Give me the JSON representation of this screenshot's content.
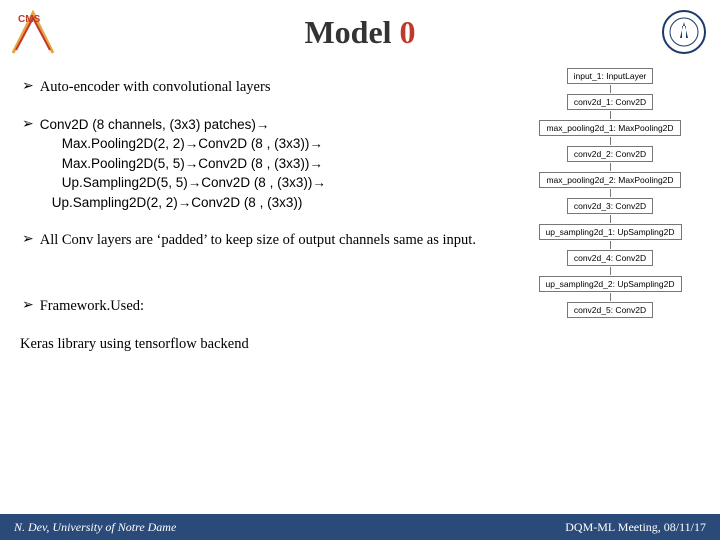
{
  "title_main": "Model ",
  "title_accent": "0",
  "logos": {
    "left_alt": "CMS logo",
    "right_alt": "Notre Dame seal"
  },
  "bullets": {
    "b1": "Auto-encoder with convolutional layers",
    "b2_l1": "Conv2D (8 channels, (3x3) patches)→",
    "b2_l2": "Max.Pooling2D(2, 2)→Conv2D (8 , (3x3))→",
    "b2_l3": "Max.Pooling2D(5, 5)→Conv2D (8 , (3x3))→",
    "b2_l4": "Up.Sampling2D(5, 5)→Conv2D (8 , (3x3))→",
    "b2_l5": "Up.Sampling2D(2, 2)→Conv2D (8 , (3x3))",
    "b3": "All Conv layers are ‘padded’ to keep size of output channels same as input.",
    "b4_l1": "Framework.Used:",
    "b4_l2": "Keras library using tensorflow backend"
  },
  "diagram": {
    "n1": "input_1: InputLayer",
    "n2": "conv2d_1: Conv2D",
    "n3": "max_pooling2d_1: MaxPooling2D",
    "n4": "conv2d_2: Conv2D",
    "n5": "max_pooling2d_2: MaxPooling2D",
    "n6": "conv2d_3: Conv2D",
    "n7": "up_sampling2d_1: UpSampling2D",
    "n8": "conv2d_4: Conv2D",
    "n9": "up_sampling2d_2: UpSampling2D",
    "n10": "conv2d_5: Conv2D"
  },
  "footer": {
    "left": "N. Dev, University of Notre Dame",
    "right": "DQM-ML Meeting, 08/11/17"
  }
}
